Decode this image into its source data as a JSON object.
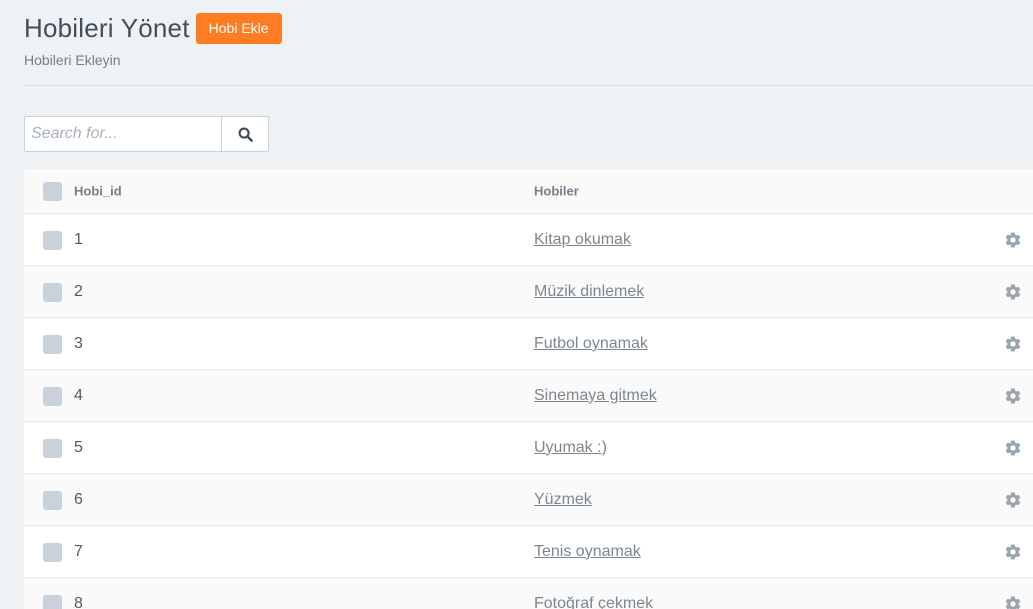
{
  "header": {
    "title": "Hobileri Yönet",
    "add_button_label": "Hobi Ekle",
    "subtitle": "Hobileri Ekleyin"
  },
  "search": {
    "placeholder": "Search for..."
  },
  "table": {
    "columns": [
      "Hobi_id",
      "Hobiler"
    ],
    "rows": [
      {
        "id": "1",
        "name": "Kitap okumak"
      },
      {
        "id": "2",
        "name": "Müzik dinlemek"
      },
      {
        "id": "3",
        "name": "Futbol oynamak"
      },
      {
        "id": "4",
        "name": "Sinemaya gitmek"
      },
      {
        "id": "5",
        "name": "Uyumak :)"
      },
      {
        "id": "6",
        "name": "Yüzmek"
      },
      {
        "id": "7",
        "name": "Tenis oynamak"
      },
      {
        "id": "8",
        "name": "Fotoğraf çekmek"
      }
    ]
  },
  "colors": {
    "accent": "#fe7d22",
    "background": "#eff2f5"
  },
  "icons": {
    "search": "search-icon",
    "row_action": "gear-icon"
  }
}
